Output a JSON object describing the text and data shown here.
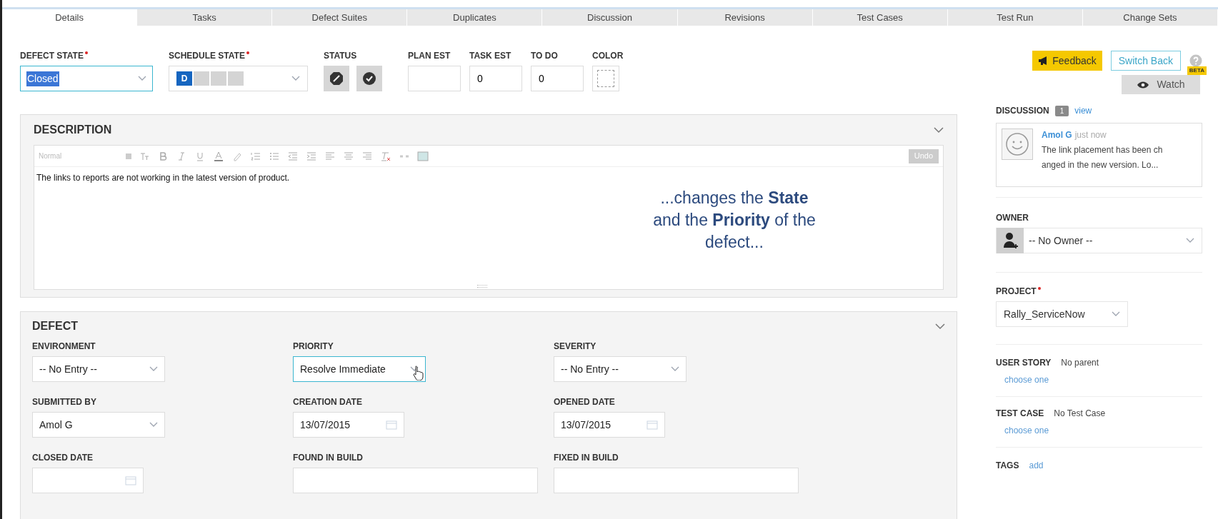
{
  "tabs": [
    {
      "label": "Details",
      "selected": true
    },
    {
      "label": "Tasks",
      "selected": false
    },
    {
      "label": "Defect Suites",
      "selected": false
    },
    {
      "label": "Duplicates",
      "selected": false
    },
    {
      "label": "Discussion",
      "selected": false
    },
    {
      "label": "Revisions",
      "selected": false
    },
    {
      "label": "Test Cases",
      "selected": false
    },
    {
      "label": "Test Run",
      "selected": false
    },
    {
      "label": "Change Sets",
      "selected": false
    }
  ],
  "header_fields": {
    "defect_state": {
      "label": "DEFECT STATE",
      "required": true,
      "value": "Closed",
      "focused": true
    },
    "schedule_state": {
      "label": "SCHEDULE STATE",
      "required": true,
      "steps": [
        {
          "label": "D",
          "selected": true
        },
        {
          "selected": false
        },
        {
          "selected": false
        },
        {
          "selected": false
        }
      ]
    },
    "status": {
      "label": "STATUS",
      "buttons": [
        {
          "kind": "blocked"
        },
        {
          "kind": "ready"
        }
      ]
    },
    "plan_est": {
      "label": "PLAN EST"
    },
    "task_est": {
      "label": "TASK EST",
      "value": "0"
    },
    "to_do": {
      "label": "TO DO",
      "value": "0"
    },
    "color": {
      "label": "COLOR"
    }
  },
  "description": {
    "title": "DESCRIPTION",
    "toolbar": {
      "format": "Normal",
      "undo": "Undo"
    },
    "text": "The links to reports are not working in the latest version of product.",
    "caption": [
      "...changes the **State**",
      "and the **Priority** of the",
      "defect..."
    ]
  },
  "defect": {
    "title": "DEFECT",
    "fields": [
      {
        "label": "ENVIRONMENT",
        "kind": "select",
        "value": "-- No Entry --",
        "focused": false
      },
      {
        "label": "PRIORITY",
        "kind": "select",
        "value": "Resolve Immediate",
        "focused": true
      },
      {
        "label": "SEVERITY",
        "kind": "select",
        "value": "-- No Entry --",
        "focused": false
      },
      {
        "label": "SUBMITTED BY",
        "kind": "select",
        "value": "Amol G",
        "focused": false
      },
      {
        "label": "CREATION DATE",
        "kind": "date",
        "value": "13/07/2015"
      },
      {
        "label": "OPENED DATE",
        "kind": "date",
        "value": "13/07/2015"
      },
      {
        "label": "CLOSED DATE",
        "kind": "date"
      },
      {
        "label": "FOUND IN BUILD",
        "kind": "text"
      },
      {
        "label": "FIXED IN BUILD",
        "kind": "text"
      }
    ]
  },
  "actions": {
    "feedback": "Feedback",
    "switch_back": "Switch Back",
    "watch": "Watch",
    "beta": "BETA"
  },
  "sidebar": {
    "discussion": {
      "label": "DISCUSSION",
      "count": "1",
      "link": "view",
      "comment": {
        "author": "Amol G",
        "time": "just now",
        "text_lines": [
          "The link placement has been ch",
          "anged in the new version. Lo..."
        ]
      }
    },
    "owner": {
      "label": "OWNER",
      "value": "-- No Owner --"
    },
    "project": {
      "label": "PROJECT",
      "required": true,
      "value": "Rally_ServiceNow"
    },
    "user_story": {
      "label": "USER STORY",
      "value": "No parent",
      "link": "choose one"
    },
    "test_case": {
      "label": "TEST CASE",
      "value": "No Test Case",
      "link": "choose one"
    },
    "tags": {
      "label": "TAGS",
      "link": "add"
    }
  }
}
